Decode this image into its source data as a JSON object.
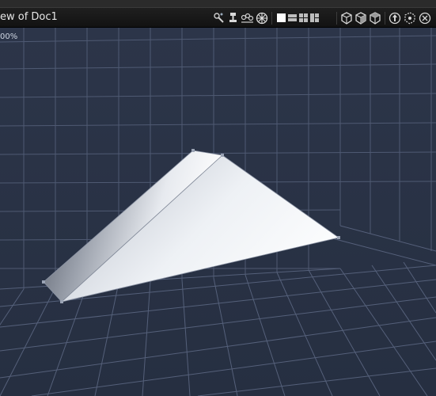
{
  "window": {
    "title": "ew of Doc1"
  },
  "viewport": {
    "zoom_label": "00%"
  },
  "toolbar": {
    "icons": [
      "tools-icon",
      "light-icon",
      "camera-group-icon",
      "orbit-icon",
      "layout-single-icon",
      "layout-stacked-icon",
      "layout-quad-icon",
      "layout-split-icon",
      "view-front-icon",
      "view-side-icon",
      "view-top-icon",
      "move-icon",
      "rotate-icon",
      "scale-icon"
    ]
  },
  "colors": {
    "background": "#2a3346",
    "grid_line": "#5a6580",
    "titlebar": "#151515",
    "title_text": "#e6e6e6",
    "object_light": "#f2f4f7",
    "object_shadow": "#6c7280"
  }
}
